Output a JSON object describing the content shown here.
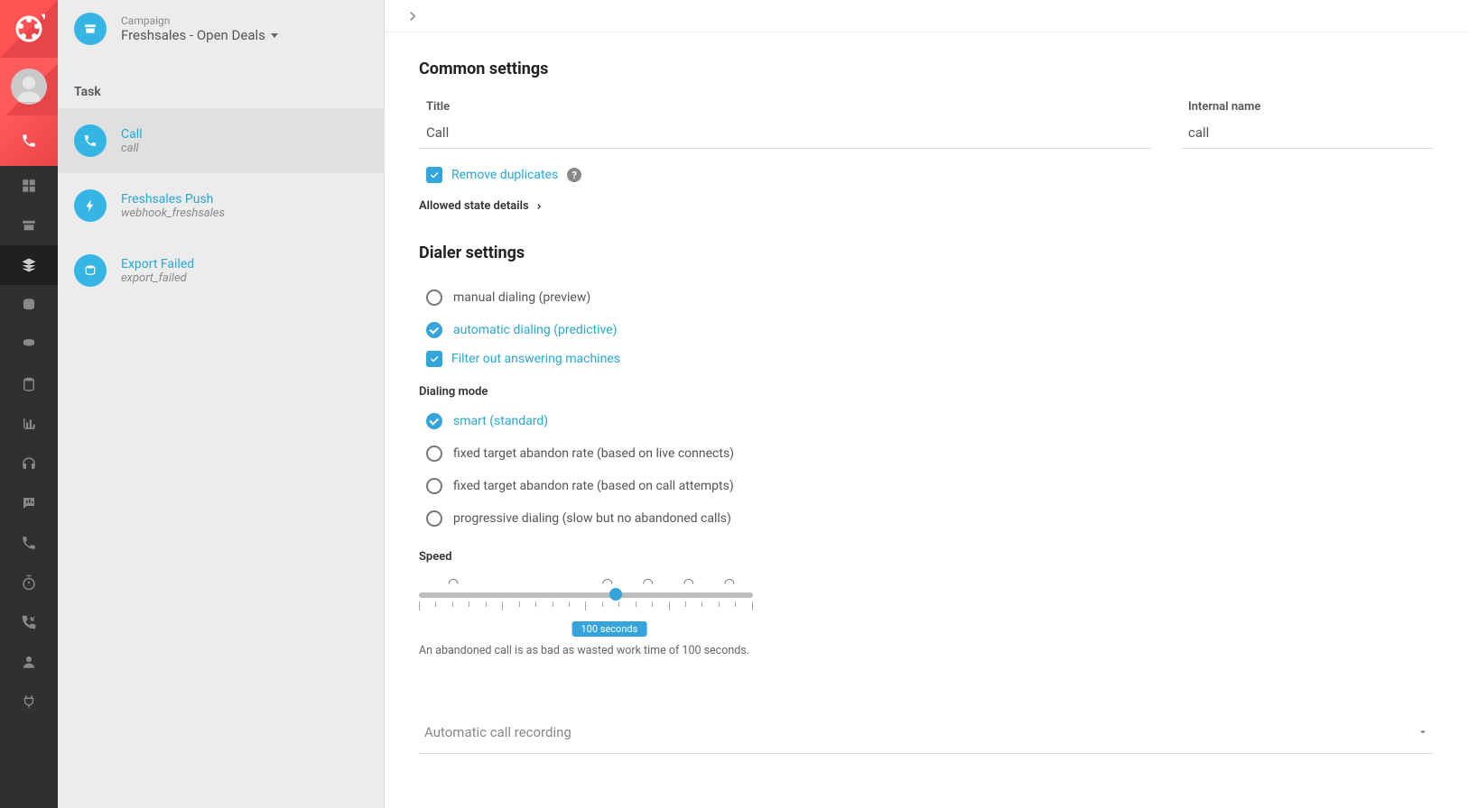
{
  "header": {
    "label": "Campaign",
    "title": "Freshsales - Open Deals"
  },
  "section_label": "Task",
  "tasks": [
    {
      "title": "Call",
      "slug": "call"
    },
    {
      "title": "Freshsales Push",
      "slug": "webhook_freshsales"
    },
    {
      "title": "Export Failed",
      "slug": "export_failed"
    }
  ],
  "common": {
    "heading": "Common settings",
    "title_label": "Title",
    "title_value": "Call",
    "internal_name_label": "Internal name",
    "internal_name_value": "call",
    "remove_dup_label": "Remove duplicates",
    "allowed_state_label": "Allowed state details"
  },
  "dialer": {
    "heading": "Dialer settings",
    "manual": "manual dialing (preview)",
    "auto": "automatic dialing (predictive)",
    "filter_am": "Filter out answering machines",
    "mode_label": "Dialing mode",
    "smart": "smart (standard)",
    "fixed_live": "fixed target abandon rate (based on live connects)",
    "fixed_attempts": "fixed target abandon rate (based on call attempts)",
    "progressive": "progressive dialing (slow but no abandoned calls)"
  },
  "speed": {
    "label": "Speed",
    "badge": "100 seconds",
    "help": "An abandoned call is as bad as wasted work time of 100 seconds.",
    "thumb_percent": 57
  },
  "accordion": {
    "recording": "Automatic call recording"
  }
}
